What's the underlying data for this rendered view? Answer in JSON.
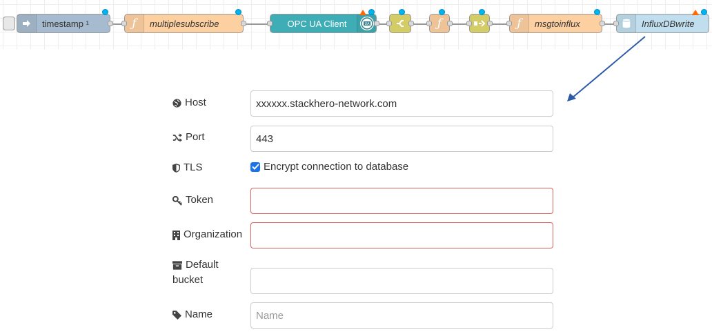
{
  "flow": {
    "nodes": [
      {
        "label": "timestamp ¹",
        "color": "#a6bbcf",
        "icon": "inject-arrow-icon",
        "italic": false
      },
      {
        "label": "multiplesubscribe",
        "color": "#fdd0a2",
        "icon": "function-icon",
        "italic": true
      },
      {
        "label": "OPC UA Client",
        "color": "#3fadb5",
        "icon": "opcua-icon",
        "italic": false
      },
      {
        "label": "",
        "color": "#e2d96e",
        "icon": "switch-icon",
        "italic": false
      },
      {
        "label": "",
        "color": "#fdd0a2",
        "icon": "function-icon",
        "italic": false
      },
      {
        "label": "",
        "color": "#e2d96e",
        "icon": "change-icon",
        "italic": false
      },
      {
        "label": "msgtoinflux",
        "color": "#fdd0a2",
        "icon": "function-icon",
        "italic": true
      },
      {
        "label": "InfluxDBwrite",
        "color": "#c0deed",
        "icon": "database-icon",
        "italic": true
      }
    ],
    "port_color": "#d9d9d9",
    "status_dot_color": "#00b4f0",
    "error_triangle_color": "#ff6a00"
  },
  "annotation": {
    "arrow_color": "#2e5aa8"
  },
  "form": {
    "host": {
      "label": "Host",
      "value": "xxxxxx.stackhero-network.com",
      "icon": "globe-icon"
    },
    "port": {
      "label": "Port",
      "value": "443",
      "icon": "random-icon"
    },
    "tls": {
      "label": "TLS",
      "checkbox_label": "Encrypt connection to database",
      "checked": true,
      "icon": "shield-icon"
    },
    "token": {
      "label": "Token",
      "value": "",
      "icon": "key-icon",
      "invalid": true
    },
    "organization": {
      "label": "Organization",
      "value": "",
      "icon": "building-icon",
      "invalid": true
    },
    "bucket": {
      "label_line1": "Default",
      "label_line2": "bucket",
      "value": "",
      "icon": "archive-icon"
    },
    "name": {
      "label": "Name",
      "value": "",
      "placeholder": "Name",
      "icon": "tag-icon"
    },
    "invalid_border_color": "#d6615f",
    "checkbox_color": "#1a73e8"
  }
}
